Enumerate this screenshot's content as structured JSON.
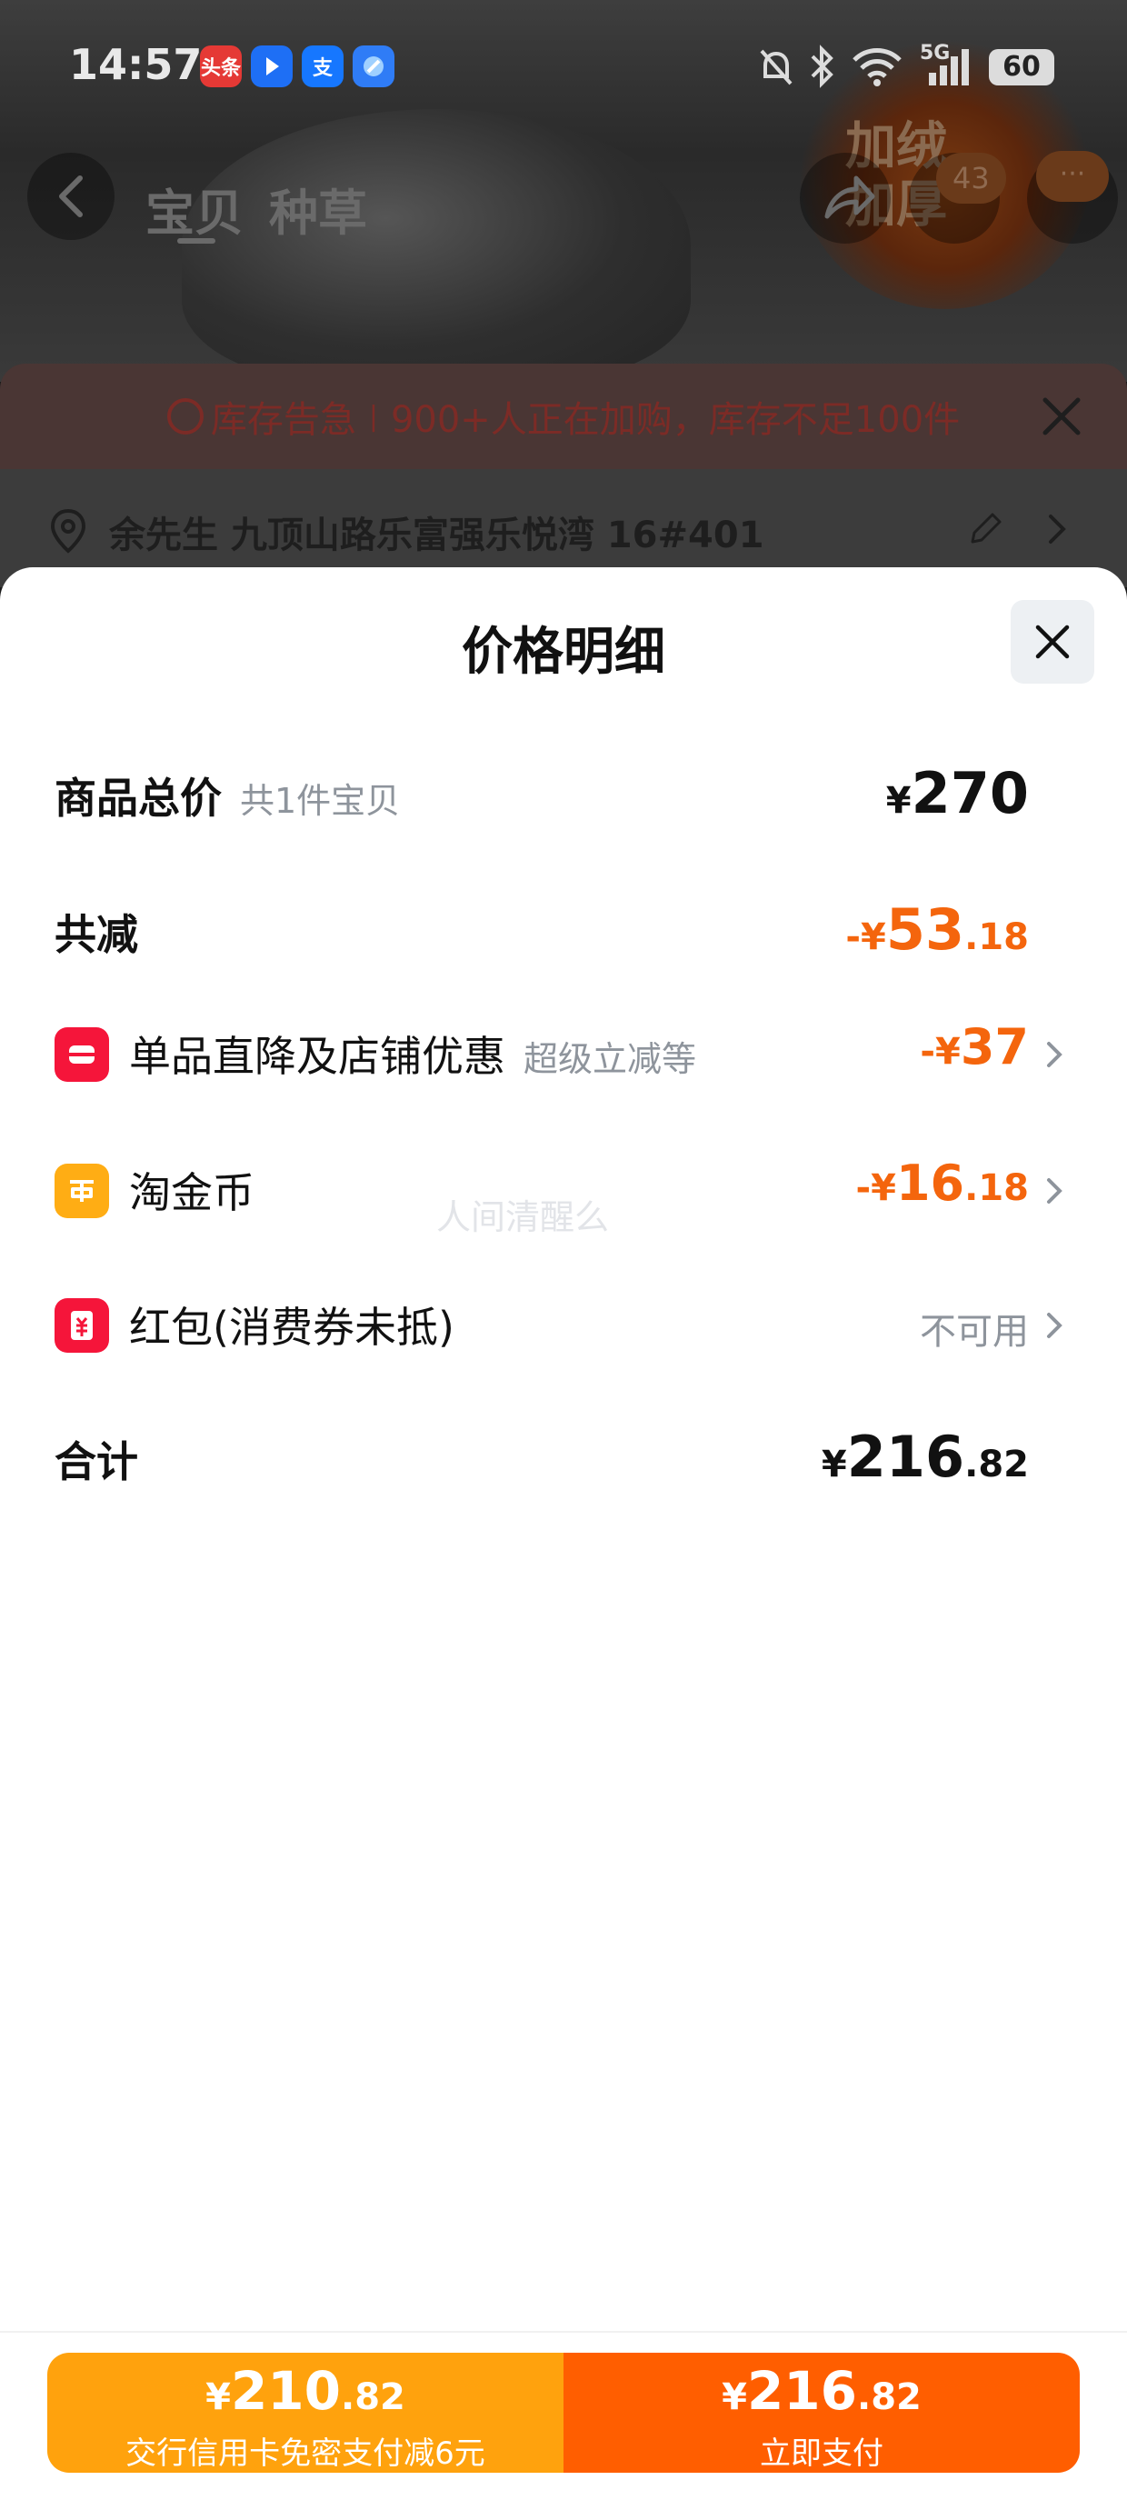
{
  "status_bar": {
    "time": "14:57",
    "battery": "60",
    "network": "5G",
    "app_icons": [
      "头条",
      "",
      "支",
      ""
    ]
  },
  "background": {
    "tabs": [
      "宝贝",
      "种草"
    ],
    "cart_badge": "43",
    "more_badge": "···",
    "promo_text": "加绒加厚",
    "stock_alert": {
      "tag": "库存告急",
      "text": "900+人正在加购，库存不足100件"
    },
    "address": "余先生 九顶山路乐富强乐悦湾 16#401"
  },
  "sheet": {
    "title": "价格明细",
    "rows": {
      "total": {
        "label": "商品总价",
        "sub": "共1件宝贝",
        "currency": "¥",
        "int": "270",
        "dec": ""
      },
      "reduction": {
        "label": "共减",
        "prefix": "-",
        "currency": "¥",
        "int": "53",
        "dec": ".18"
      },
      "discount": {
        "label": "单品直降及店铺优惠",
        "sub": "超级立减等",
        "prefix": "-",
        "currency": "¥",
        "int": "37",
        "dec": ""
      },
      "coins": {
        "label": "淘金币",
        "prefix": "-",
        "currency": "¥",
        "int": "16",
        "dec": ".18"
      },
      "red_packet": {
        "label": "红包(消费券未抵)",
        "status": "不可用"
      },
      "sum": {
        "label": "合计",
        "currency": "¥",
        "int": "216",
        "dec": ".82"
      }
    },
    "watermark": "人间清醒么"
  },
  "bottom_bar": {
    "left": {
      "currency": "¥",
      "int": "210",
      "dec": ".82",
      "sub": "交行信用卡免密支付减6元"
    },
    "right": {
      "currency": "¥",
      "int": "216",
      "dec": ".82",
      "sub": "立即支付"
    }
  },
  "colors": {
    "accent_orange": "#f4650d",
    "pay_left": "#ffa20d",
    "pay_right": "#ff5e00",
    "shop_icon": "#f5153a",
    "coin_icon": "#ffad14"
  }
}
